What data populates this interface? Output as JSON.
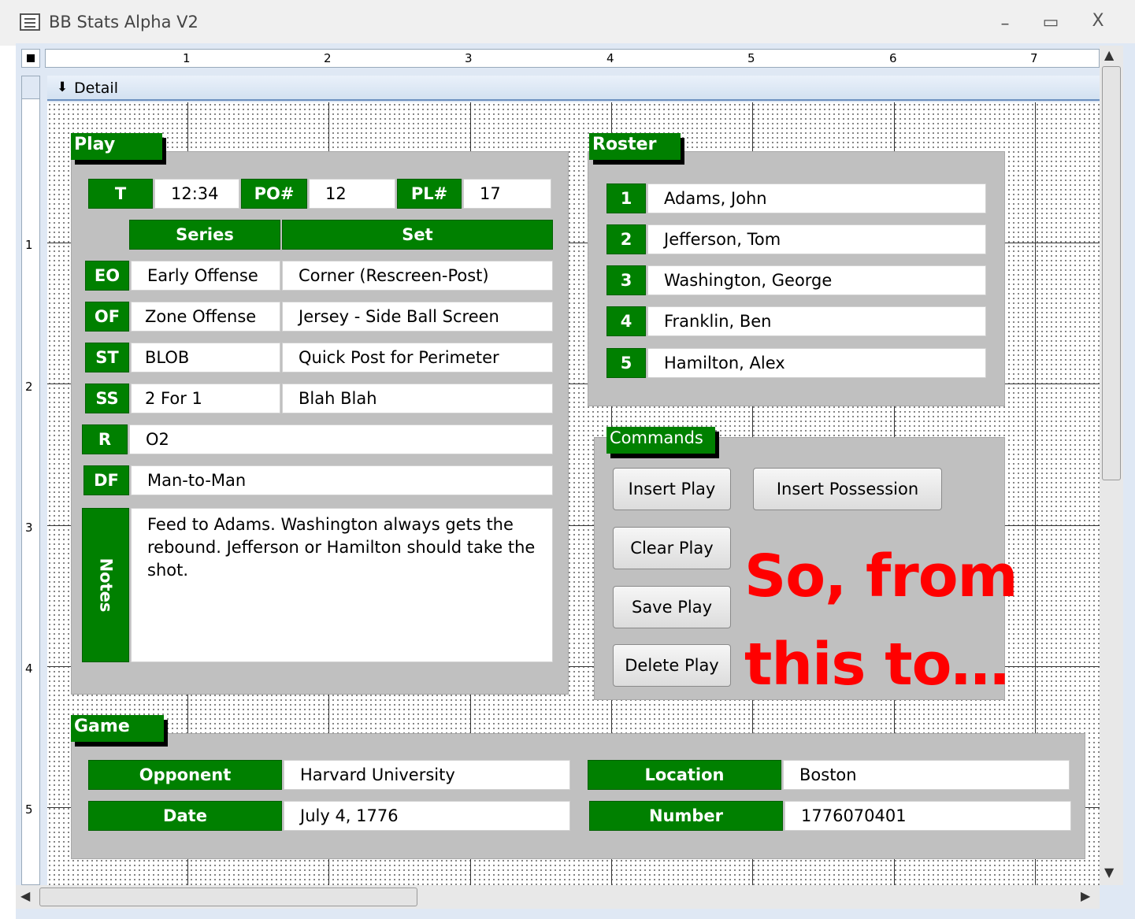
{
  "window": {
    "title": "BB Stats Alpha V2",
    "minimize": "–",
    "maximize": "▭",
    "close": "X"
  },
  "ruler": {
    "marks": [
      "1",
      "2",
      "3",
      "4",
      "5",
      "6",
      "7"
    ],
    "vmarks": [
      "1",
      "2",
      "3",
      "4",
      "5"
    ]
  },
  "section": {
    "detail_label": "Detail"
  },
  "play": {
    "tab": "Play",
    "t_label": "T",
    "t_value": "12:34",
    "po_label": "PO#",
    "po_value": "12",
    "pl_label": "PL#",
    "pl_value": "17",
    "series_header": "Series",
    "set_header": "Set",
    "rows": [
      {
        "code": "EO",
        "series": "Early Offense",
        "set": "Corner (Rescreen-Post)"
      },
      {
        "code": "OF",
        "series": "Zone Offense",
        "set": "Jersey - Side Ball Screen"
      },
      {
        "code": "ST",
        "series": "BLOB",
        "set": "Quick Post for Perimeter"
      },
      {
        "code": "SS",
        "series": "2 For 1",
        "set": "Blah Blah"
      }
    ],
    "r_label": "R",
    "r_value": "O2",
    "df_label": "DF",
    "df_value": "Man-to-Man",
    "notes_label": "Notes",
    "notes_value": "Feed to Adams.  Washington always gets the rebound.  Jefferson or Hamilton should take the shot."
  },
  "roster": {
    "tab": "Roster",
    "players": [
      {
        "num": "1",
        "name": "Adams, John"
      },
      {
        "num": "2",
        "name": "Jefferson, Tom"
      },
      {
        "num": "3",
        "name": "Washington, George"
      },
      {
        "num": "4",
        "name": "Franklin, Ben"
      },
      {
        "num": "5",
        "name": "Hamilton, Alex"
      }
    ]
  },
  "commands": {
    "tab": "Commands",
    "insert_play": "Insert Play",
    "insert_possession": "Insert Possession",
    "clear_play": "Clear Play",
    "save_play": "Save Play",
    "delete_play": "Delete Play"
  },
  "game": {
    "tab": "Game",
    "opponent_label": "Opponent",
    "opponent_value": "Harvard University",
    "location_label": "Location",
    "location_value": "Boston",
    "date_label": "Date",
    "date_value": "July 4, 1776",
    "number_label": "Number",
    "number_value": "1776070401"
  },
  "overlay": {
    "line1": "So, from",
    "line2": "this to…"
  },
  "colors": {
    "accent_green": "#008000",
    "panel_gray": "#c0c0c0",
    "overlay_red": "#ff0000"
  }
}
